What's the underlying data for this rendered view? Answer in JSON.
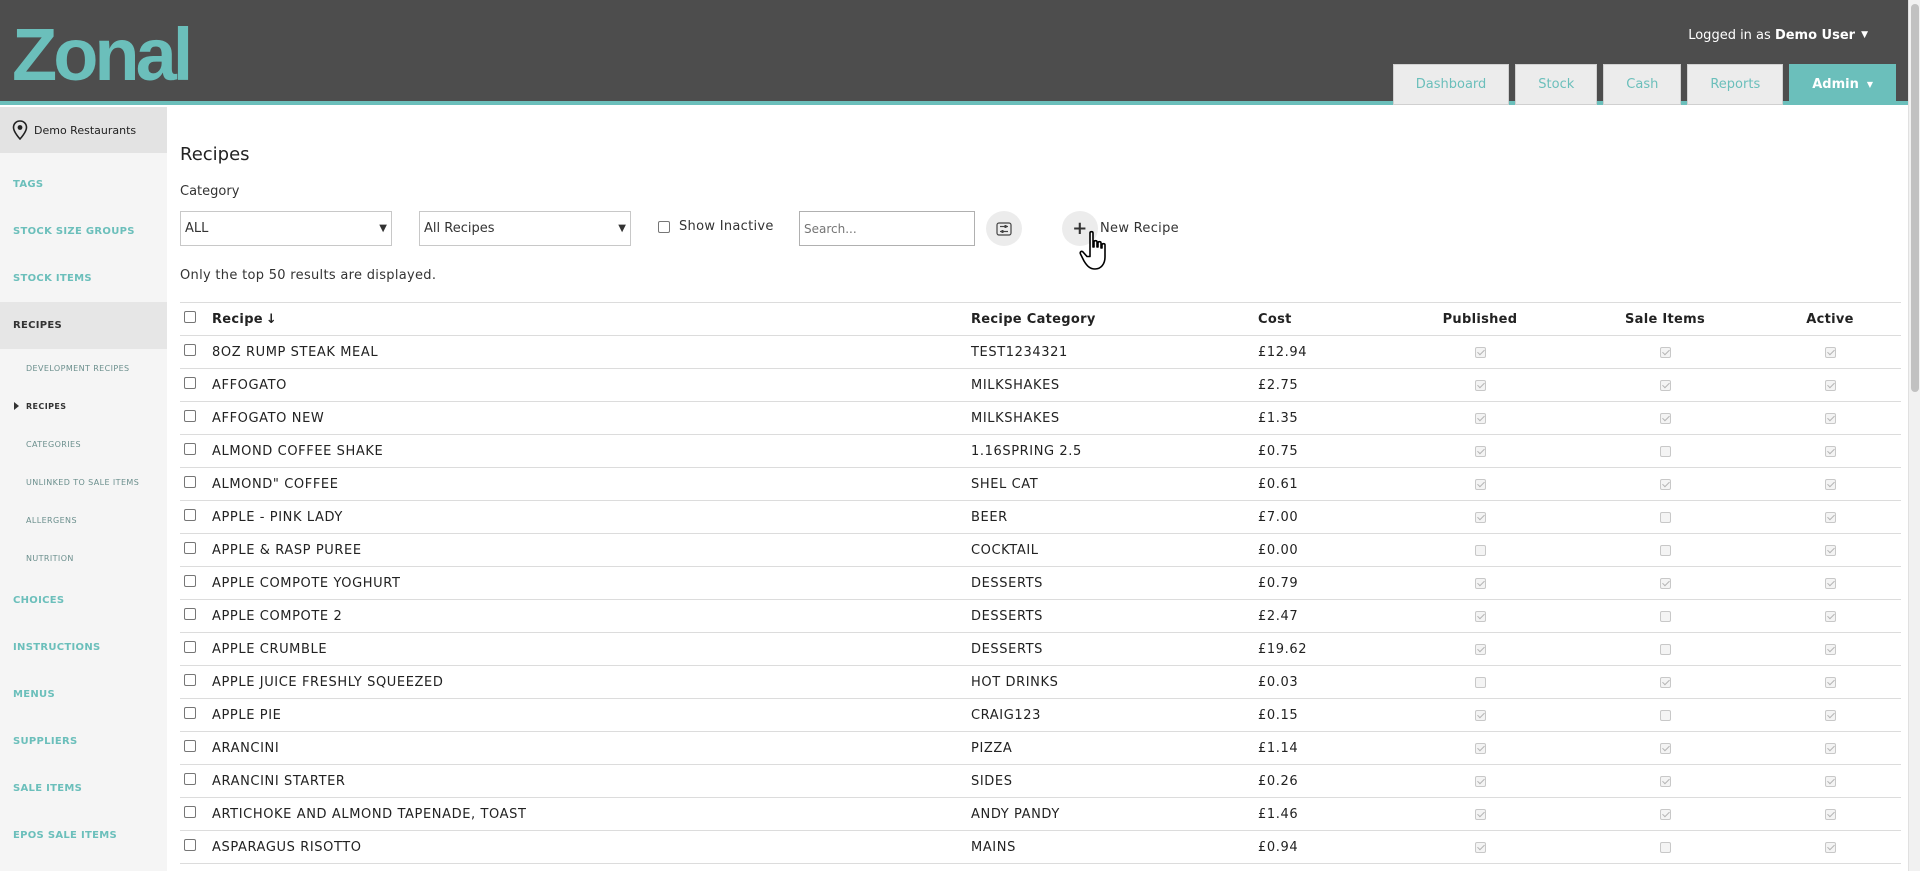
{
  "header": {
    "logo_text": "Zonal",
    "logged_in_prefix": "Logged in as ",
    "user_name": "Demo User",
    "nav": [
      {
        "label": "Dashboard"
      },
      {
        "label": "Stock"
      },
      {
        "label": "Cash"
      },
      {
        "label": "Reports"
      },
      {
        "label": "Admin"
      }
    ],
    "accent_color": "#6bbfbb",
    "header_color": "#4d4d4d"
  },
  "sidebar": {
    "site_name": "Demo Restaurants",
    "items": [
      {
        "label": "TAGS"
      },
      {
        "label": "STOCK SIZE GROUPS"
      },
      {
        "label": "STOCK ITEMS"
      },
      {
        "label": "RECIPES"
      },
      {
        "label": "DEVELOPMENT RECIPES"
      },
      {
        "label": "RECIPES"
      },
      {
        "label": "CATEGORIES"
      },
      {
        "label": "UNLINKED TO SALE ITEMS"
      },
      {
        "label": "ALLERGENS"
      },
      {
        "label": "NUTRITION"
      },
      {
        "label": "CHOICES"
      },
      {
        "label": "INSTRUCTIONS"
      },
      {
        "label": "MENUS"
      },
      {
        "label": "SUPPLIERS"
      },
      {
        "label": "SALE ITEMS"
      },
      {
        "label": "EPOS SALE ITEMS"
      }
    ]
  },
  "main": {
    "title": "Recipes",
    "category_label": "Category",
    "category_value": "ALL",
    "recipe_filter_value": "All Recipes",
    "show_inactive_label": "Show Inactive",
    "search_placeholder": "Search...",
    "new_recipe_label": "New Recipe",
    "note": "Only the top 50 results are displayed."
  },
  "table": {
    "columns": {
      "recipe": "Recipe",
      "sort_arrow": "↓",
      "category": "Recipe Category",
      "cost": "Cost",
      "published": "Published",
      "sale_items": "Sale Items",
      "active": "Active"
    },
    "rows": [
      {
        "name": "8OZ RUMP STEAK MEAL",
        "category": "TEST1234321",
        "cost": "£12.94",
        "published": true,
        "sale": true,
        "active": true
      },
      {
        "name": "AFFOGATO",
        "category": "MILKSHAKES",
        "cost": "£2.75",
        "published": true,
        "sale": true,
        "active": true
      },
      {
        "name": "AFFOGATO NEW",
        "category": "MILKSHAKES",
        "cost": "£1.35",
        "published": true,
        "sale": true,
        "active": true
      },
      {
        "name": "ALMOND COFFEE SHAKE",
        "category": "1.16SPRING 2.5",
        "cost": "£0.75",
        "published": true,
        "sale": false,
        "active": true
      },
      {
        "name": "ALMOND\" COFFEE",
        "category": "SHEL CAT",
        "cost": "£0.61",
        "published": true,
        "sale": true,
        "active": true
      },
      {
        "name": "APPLE - PINK LADY",
        "category": "BEER",
        "cost": "£7.00",
        "published": true,
        "sale": false,
        "active": true
      },
      {
        "name": "APPLE & RASP PUREE",
        "category": "COCKTAIL",
        "cost": "£0.00",
        "published": false,
        "sale": false,
        "active": true
      },
      {
        "name": "APPLE COMPOTE YOGHURT",
        "category": "DESSERTS",
        "cost": "£0.79",
        "published": true,
        "sale": true,
        "active": true
      },
      {
        "name": "APPLE COMPOTE 2",
        "category": "DESSERTS",
        "cost": "£2.47",
        "published": true,
        "sale": false,
        "active": true
      },
      {
        "name": "APPLE CRUMBLE",
        "category": "DESSERTS",
        "cost": "£19.62",
        "published": true,
        "sale": false,
        "active": true
      },
      {
        "name": "APPLE JUICE FRESHLY SQUEEZED",
        "category": "HOT DRINKS",
        "cost": "£0.03",
        "published": false,
        "sale": true,
        "active": true
      },
      {
        "name": "APPLE PIE",
        "category": "CRAIG123",
        "cost": "£0.15",
        "published": true,
        "sale": false,
        "active": true
      },
      {
        "name": "ARANCINI",
        "category": "PIZZA",
        "cost": "£1.14",
        "published": true,
        "sale": true,
        "active": true
      },
      {
        "name": "ARANCINI STARTER",
        "category": "SIDES",
        "cost": "£0.26",
        "published": true,
        "sale": true,
        "active": true
      },
      {
        "name": "ARTICHOKE AND ALMOND TAPENADE, TOAST",
        "category": "ANDY PANDY",
        "cost": "£1.46",
        "published": true,
        "sale": true,
        "active": true
      },
      {
        "name": "ASPARAGUS RISOTTO",
        "category": "MAINS",
        "cost": "£0.94",
        "published": true,
        "sale": false,
        "active": true
      }
    ]
  }
}
